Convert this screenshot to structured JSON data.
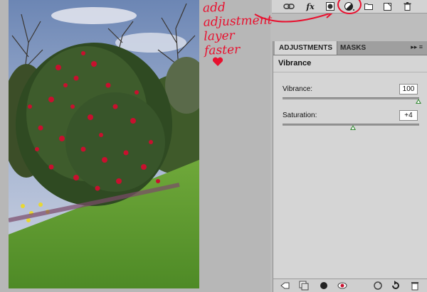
{
  "annotation": {
    "lines": [
      "add",
      "adjustment",
      "layer",
      "faster"
    ],
    "color": "#e8102e"
  },
  "layers_toolbar": {
    "icons": [
      "link-icon",
      "fx-icon",
      "layer-mask-icon",
      "adjustment-layer-icon",
      "group-folder-icon",
      "new-layer-icon",
      "trash-icon"
    ],
    "fx_label": "fx"
  },
  "panel": {
    "tabs": [
      {
        "label": "ADJUSTMENTS",
        "active": true
      },
      {
        "label": "MASKS",
        "active": false
      }
    ],
    "menu_glyph": "▸▸ ≡",
    "title": "Vibrance",
    "adjustments": [
      {
        "label": "Vibrance:",
        "value": "100",
        "slider_position_pct": 100
      },
      {
        "label": "Saturation:",
        "value": "+4",
        "slider_position_pct": 52
      }
    ],
    "accent": "#3a8c3a"
  },
  "bottom_bar": {
    "icons": [
      "back-arrow-icon",
      "clip-layer-icon",
      "eye-visibility-icon",
      "view-previous-icon",
      "reset-icon",
      "delete-icon"
    ]
  }
}
